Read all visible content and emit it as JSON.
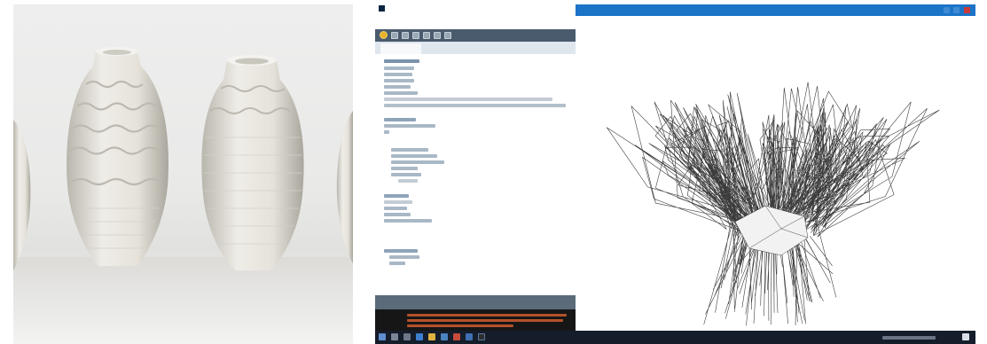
{
  "photo": {
    "subject": "three-white-ceramic-vases",
    "colors": {
      "background": "#ececeb",
      "glaze": "#e4e2dc",
      "shadow": "#bdbab2"
    }
  },
  "ide": {
    "window_title": "",
    "menu": [
      "",
      "",
      "",
      "",
      ""
    ],
    "tab_label": "",
    "colors": {
      "toolbar": "#4a5b6e",
      "status": "#5b6b7a",
      "console": "#161616",
      "run_button": "#e8b32a"
    }
  },
  "sketch": {
    "window_title": "",
    "colors": {
      "titlebar": "#1b74c8",
      "wireframe": "#1a1a1a"
    }
  },
  "taskbar": {
    "clock": "",
    "colors": {
      "bar": "#151c2a"
    }
  }
}
